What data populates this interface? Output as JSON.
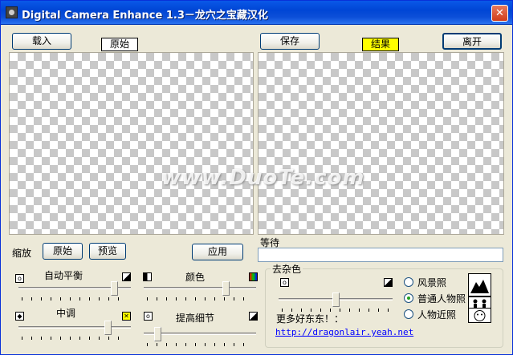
{
  "window": {
    "title": "Digital Camera Enhance 1.3－龙穴之宝藏汉化",
    "close_glyph": "✕"
  },
  "toolbar": {
    "load": "载入",
    "original_tag": "原始",
    "save": "保存",
    "result_tag": "结果",
    "exit": "离开"
  },
  "result_tag_color": "#ffff00",
  "zoom": {
    "label": "缩放",
    "original": "原始",
    "preview": "预览"
  },
  "apply": "应用",
  "status": {
    "text": "等待"
  },
  "adjust": {
    "auto_balance": "自动平衡",
    "color": "颜色",
    "midtone": "中调",
    "detail": "提高细节"
  },
  "denoise": {
    "group_title": "去杂色"
  },
  "presets": {
    "landscape": "风景照",
    "normal_portrait": "普通人物照",
    "closeup_portrait": "人物近照",
    "selected": "普通人物照"
  },
  "more": {
    "label": "更多好东东！：",
    "url": "http://dragonlair.yeah.net"
  },
  "watermark": "www.DuoTe.com",
  "sliders": {
    "auto_balance": 0.88,
    "color": 0.75,
    "midtone": 0.82,
    "detail": 0.1,
    "denoise": 0.5
  }
}
